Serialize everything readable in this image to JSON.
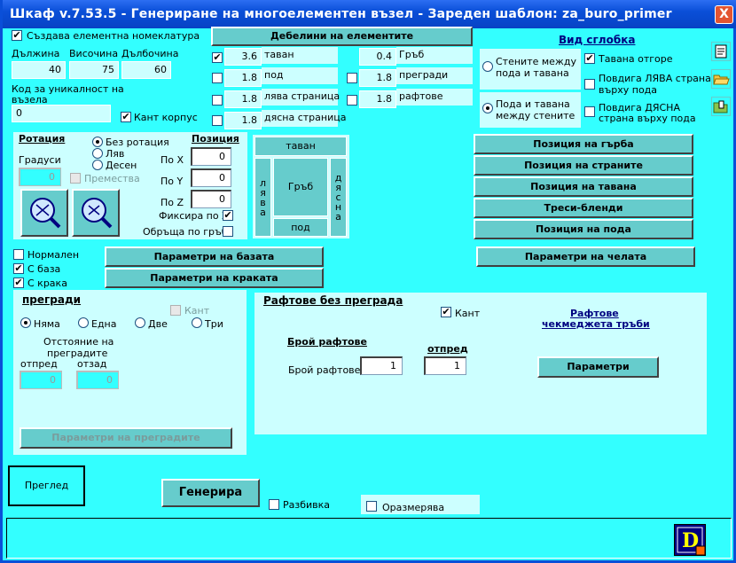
{
  "window": {
    "title": "Шкаф v.7.53.5 - Генериране на многоелементен възел - Зареден шаблон: za_buro_primer",
    "close": "X"
  },
  "top": {
    "nomenclature": {
      "label": "Създава елементна номеклатура",
      "checked": true
    },
    "dims": {
      "length_label": "Дължина",
      "height_label": "Височина",
      "depth_label": "Дълбочина",
      "length": "40",
      "height": "75",
      "depth": "60"
    },
    "uniq_label_1": "Код за уникалност на",
    "uniq_label_2": "възела",
    "uniq_value": "0",
    "kant_korpus": {
      "label": "Кант корпус",
      "checked": true
    }
  },
  "thickness": {
    "header": "Дебелини на елементите",
    "rows_left": [
      {
        "checked": true,
        "value": "3.6",
        "label": "таван"
      },
      {
        "checked": false,
        "value": "1.8",
        "label": "под"
      },
      {
        "checked": false,
        "value": "1.8",
        "label": "лява страница"
      },
      {
        "checked": false,
        "value": "1.8",
        "label": "дясна страница"
      }
    ],
    "rows_right": [
      {
        "value": "0.4",
        "label": "Гръб",
        "has_check": false
      },
      {
        "value": "1.8",
        "label": "прегради",
        "has_check": true,
        "checked": false
      },
      {
        "value": "1.8",
        "label": "рафтове",
        "has_check": true,
        "checked": false
      }
    ]
  },
  "joint": {
    "title": "Вид сглобка",
    "opt1": "Стените между\nпода и тавана",
    "opt1_l1": "Стените между",
    "opt1_l2": "пода и тавана",
    "opt2_l1": "Пода и тавана",
    "opt2_l2": "между стените",
    "top_outside": {
      "label": "Тавана отгоре",
      "checked": true
    },
    "lift_left_l1": "Повдига ЛЯВА страна",
    "lift_left_l2": "върху пода",
    "lift_right_l1": "Повдига ДЯСНА",
    "lift_right_l2": "страна върху пода"
  },
  "rotation": {
    "title": "Ротация",
    "opt_none": "Без ротация",
    "opt_left": "Ляв",
    "opt_right": "Десен",
    "degrees_label": "Градуси",
    "degrees_value": "0",
    "moves_label": "Премества"
  },
  "position": {
    "title": "Позиция",
    "x_label": "По X",
    "y_label": "По Y",
    "z_label": "По Z",
    "x": "0",
    "y": "0",
    "z": "0",
    "fix_z": "Фиксира по Z",
    "flip_back": "Обръща по гръб"
  },
  "diagram": {
    "top": "таван",
    "left": [
      "л",
      "я",
      "в",
      "а"
    ],
    "back": "Гръб",
    "right": [
      "д",
      "я",
      "с",
      "н",
      "а"
    ],
    "bottom": "под"
  },
  "right_buttons": [
    "Позиция на гърба",
    "Позиция на страните",
    "Позиция на тавана",
    "Треси-бленди",
    "Позиция на пода"
  ],
  "base": {
    "normal": {
      "label": "Нормален",
      "checked": false
    },
    "with_base": {
      "label": "С база",
      "checked": true
    },
    "with_legs": {
      "label": "С крака",
      "checked": true
    },
    "base_params": "Параметри на базата",
    "legs_params": "Параметри на краката",
    "front_params": "Параметри на челата"
  },
  "partitions": {
    "title": "прегради",
    "kant": "Кант",
    "opt_none": "Няма",
    "opt_one": "Една",
    "opt_two": "Две",
    "opt_three": "Три",
    "distance_l1": "Отстояние на",
    "distance_l2": "преградите",
    "front_label": "отпред",
    "back_label": "отзад",
    "front": "0",
    "back": "0",
    "params": "Параметри на преградите"
  },
  "shelves": {
    "title": "Рафтове без преграда",
    "kant": {
      "label": "Кант",
      "checked": true
    },
    "count_title": "Брой рафтове",
    "count_label": "Брой рафтове",
    "count": "1",
    "front_title": "отпред",
    "front": "1",
    "drawers_l1": "Рафтове",
    "drawers_l2": "чекмеджета тръби",
    "params": "Параметри"
  },
  "bottom": {
    "preview": "Преглед",
    "generate": "Генерира",
    "explode": "Разбивка",
    "dimension": "Оразмерява",
    "logo": "D"
  },
  "colors": {
    "bg": "#33ffff",
    "panel": "#ccffff",
    "button": "#66cccc",
    "title": "#0a4fd8"
  }
}
